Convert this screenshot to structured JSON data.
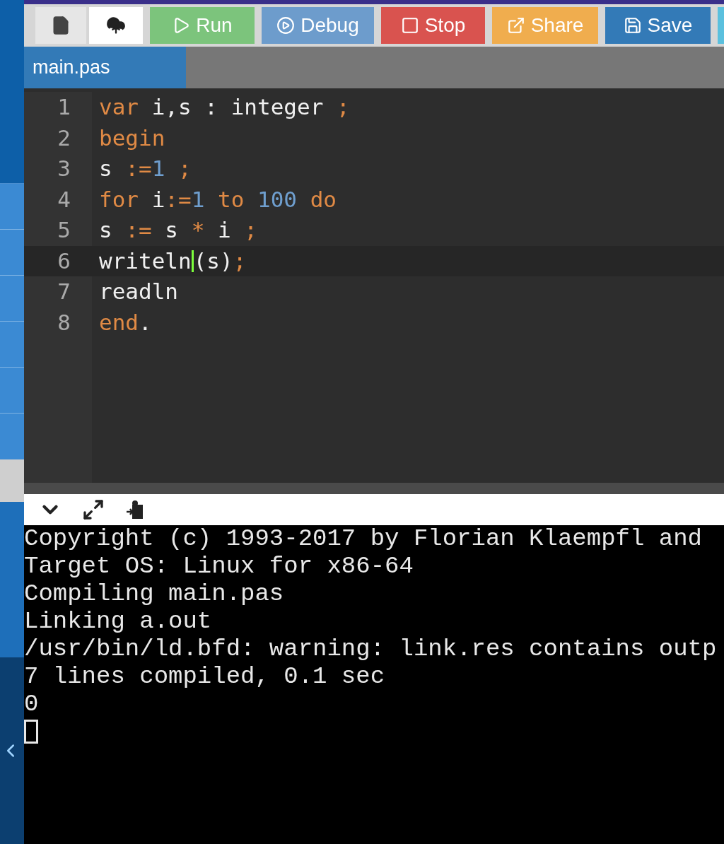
{
  "toolbar": {
    "buttons": [
      {
        "kind": "new-file"
      },
      {
        "kind": "upload"
      },
      {
        "kind": "run",
        "label": "Run"
      },
      {
        "kind": "debug",
        "label": "Debug"
      },
      {
        "kind": "stop",
        "label": "Stop"
      },
      {
        "kind": "share",
        "label": "Share"
      },
      {
        "kind": "save",
        "label": "Save"
      }
    ]
  },
  "tabs": [
    {
      "label": "main.pas",
      "selected": true
    }
  ],
  "editor": {
    "lines": [
      {
        "number": "1",
        "active": false,
        "tokens": [
          {
            "kind": "keyword",
            "text": "var"
          },
          {
            "kind": "plain",
            "text": " i,s : integer "
          },
          {
            "kind": "operator",
            "text": ";"
          }
        ]
      },
      {
        "number": "2",
        "active": false,
        "tokens": [
          {
            "kind": "keyword",
            "text": "begin"
          }
        ]
      },
      {
        "number": "3",
        "active": false,
        "tokens": [
          {
            "kind": "plain",
            "text": "s "
          },
          {
            "kind": "operator",
            "text": ":="
          },
          {
            "kind": "number",
            "text": "1"
          },
          {
            "kind": "operator",
            "text": " ;"
          }
        ]
      },
      {
        "number": "4",
        "active": false,
        "tokens": [
          {
            "kind": "keyword",
            "text": "for"
          },
          {
            "kind": "plain",
            "text": " i"
          },
          {
            "kind": "operator",
            "text": ":="
          },
          {
            "kind": "number",
            "text": "1"
          },
          {
            "kind": "keyword",
            "text": " to"
          },
          {
            "kind": "number",
            "text": " 100"
          },
          {
            "kind": "keyword",
            "text": " do"
          }
        ]
      },
      {
        "number": "5",
        "active": false,
        "tokens": [
          {
            "kind": "plain",
            "text": "s "
          },
          {
            "kind": "operator",
            "text": ":="
          },
          {
            "kind": "plain",
            "text": " s "
          },
          {
            "kind": "operator",
            "text": "*"
          },
          {
            "kind": "plain",
            "text": " i "
          },
          {
            "kind": "operator",
            "text": ";"
          }
        ]
      },
      {
        "number": "6",
        "active": true,
        "tokens": [
          {
            "kind": "plain",
            "text": "writeln"
          },
          {
            "kind": "cursor"
          },
          {
            "kind": "plain",
            "text": "(s)"
          },
          {
            "kind": "operator",
            "text": ";"
          }
        ]
      },
      {
        "number": "7",
        "active": false,
        "tokens": [
          {
            "kind": "plain",
            "text": "readln"
          }
        ]
      },
      {
        "number": "8",
        "active": false,
        "tokens": [
          {
            "kind": "keyword",
            "text": "end"
          },
          {
            "kind": "plain",
            "text": "."
          }
        ]
      }
    ]
  },
  "console": {
    "lines": [
      "Copyright (c) 1993-2017 by Florian Klaempfl and",
      "Target OS: Linux for x86-64",
      "Compiling main.pas",
      "Linking a.out",
      "/usr/bin/ld.bfd: warning: link.res contains outp",
      "7 lines compiled, 0.1 sec",
      "0"
    ],
    "cursor": true
  }
}
